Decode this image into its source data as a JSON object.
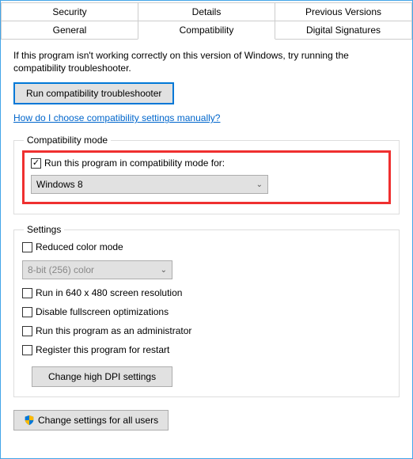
{
  "tabs": {
    "row1": [
      "Security",
      "Details",
      "Previous Versions"
    ],
    "row2": [
      "General",
      "Compatibility",
      "Digital Signatures"
    ],
    "active": "Compatibility"
  },
  "intro": "If this program isn't working correctly on this version of Windows, try running the compatibility troubleshooter.",
  "buttons": {
    "troubleshoot": "Run compatibility troubleshooter",
    "dpi": "Change high DPI settings",
    "allUsers": "Change settings for all users"
  },
  "link": "How do I choose compatibility settings manually?",
  "groups": {
    "compat": {
      "legend": "Compatibility mode",
      "checkLabel": "Run this program in compatibility mode for:",
      "checked": true,
      "selected": "Windows 8"
    },
    "settings": {
      "legend": "Settings",
      "items": [
        {
          "label": "Reduced color mode",
          "checked": false
        },
        {
          "label": "Run in 640 x 480 screen resolution",
          "checked": false
        },
        {
          "label": "Disable fullscreen optimizations",
          "checked": false
        },
        {
          "label": "Run this program as an administrator",
          "checked": false
        },
        {
          "label": "Register this program for restart",
          "checked": false
        }
      ],
      "colorSelect": "8-bit (256) color"
    }
  }
}
